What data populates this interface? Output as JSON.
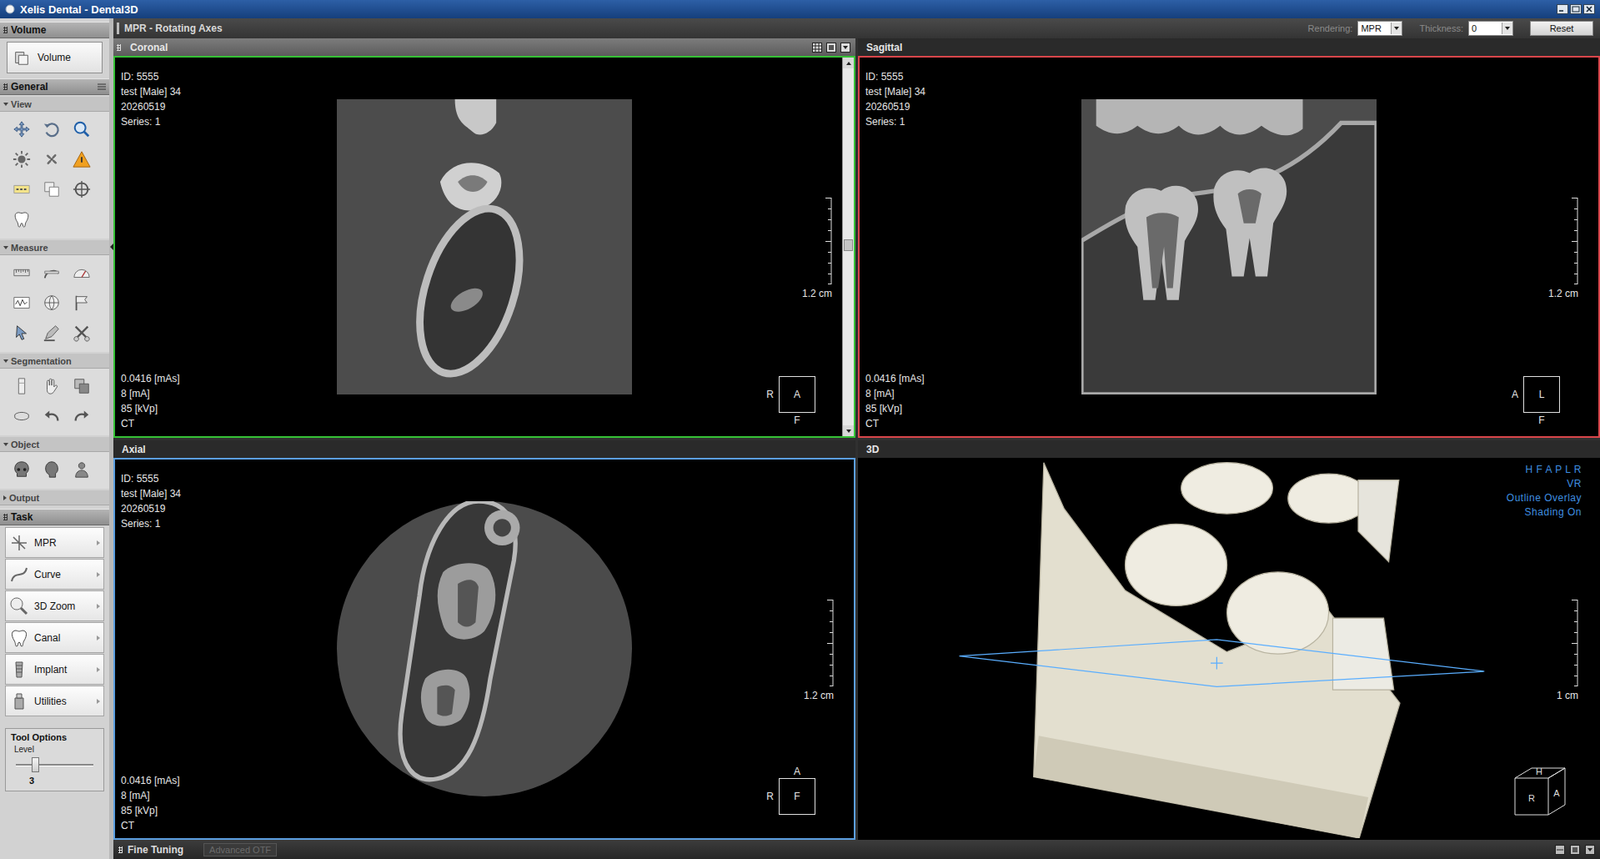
{
  "window": {
    "title": "Xelis Dental - Dental3D"
  },
  "sidebar": {
    "volume": {
      "title": "Volume",
      "button": "Volume"
    },
    "general": {
      "title": "General",
      "groups": [
        {
          "title": "View",
          "expanded": true
        },
        {
          "title": "Measure",
          "expanded": true
        },
        {
          "title": "Segmentation",
          "expanded": true
        },
        {
          "title": "Object",
          "expanded": true
        },
        {
          "title": "Output",
          "expanded": false
        }
      ]
    },
    "task": {
      "title": "Task",
      "items": [
        {
          "label": "MPR",
          "selected": false
        },
        {
          "label": "Curve",
          "selected": false
        },
        {
          "label": "3D Zoom",
          "selected": false
        },
        {
          "label": "Canal",
          "selected": false
        },
        {
          "label": "Implant",
          "selected": false
        },
        {
          "label": "Utilities",
          "selected": false
        }
      ]
    },
    "tool_options": {
      "title": "Tool Options",
      "label": "Level",
      "value": "3",
      "level": 0.25
    }
  },
  "toolbar": {
    "title": "MPR - Rotating Axes",
    "rendering_label": "Rendering:",
    "rendering_value": "MPR",
    "thickness_label": "Thickness:",
    "thickness_value": "0",
    "reset": "Reset"
  },
  "viewports": [
    {
      "title": "Coronal",
      "kind": "coronal",
      "selected": true,
      "color": "#36c236",
      "info": [
        "ID: 5555",
        "test [Male] 34",
        "20260519",
        "Series: 1"
      ],
      "exposure": [
        "0.0416 [mAs]",
        "8 [mA]",
        "85 [kVp]",
        "CT"
      ],
      "scale": "1.2 cm",
      "orientation": {
        "left": "R",
        "center": "A",
        "bottom": "F"
      },
      "scroll_level": 0.48
    },
    {
      "title": "Sagittal",
      "kind": "sagittal",
      "selected": false,
      "color": "#d9464b",
      "info": [
        "ID: 5555",
        "test [Male] 34",
        "20260519",
        "Series: 1"
      ],
      "exposure": [
        "0.0416 [mAs]",
        "8 [mA]",
        "85 [kVp]",
        "CT"
      ],
      "scale": "1.2 cm",
      "orientation": {
        "left": "A",
        "center": "L",
        "bottom": "F"
      }
    },
    {
      "title": "Axial",
      "kind": "axial",
      "selected": false,
      "color": "#5c9fe0",
      "info": [
        "ID: 5555",
        "test [Male] 34",
        "20260519",
        "Series: 1"
      ],
      "exposure": [
        "0.0416 [mAs]",
        "8 [mA]",
        "85 [kVp]",
        "CT"
      ],
      "scale": "1.2 cm",
      "orientation": {
        "top": "A",
        "left": "R",
        "center": "F"
      }
    },
    {
      "title": "3D",
      "kind": "volume",
      "selected": false,
      "color": null,
      "render_info": [
        "H F A P L R",
        "VR",
        "Outline Overlay",
        "Shading On"
      ],
      "scale": "1 cm",
      "cube": {
        "top": "H",
        "left": "R",
        "right": "A"
      }
    }
  ],
  "fine_tuning": {
    "title": "Fine Tuning",
    "button": "Advanced OTF",
    "button_disabled": true
  }
}
